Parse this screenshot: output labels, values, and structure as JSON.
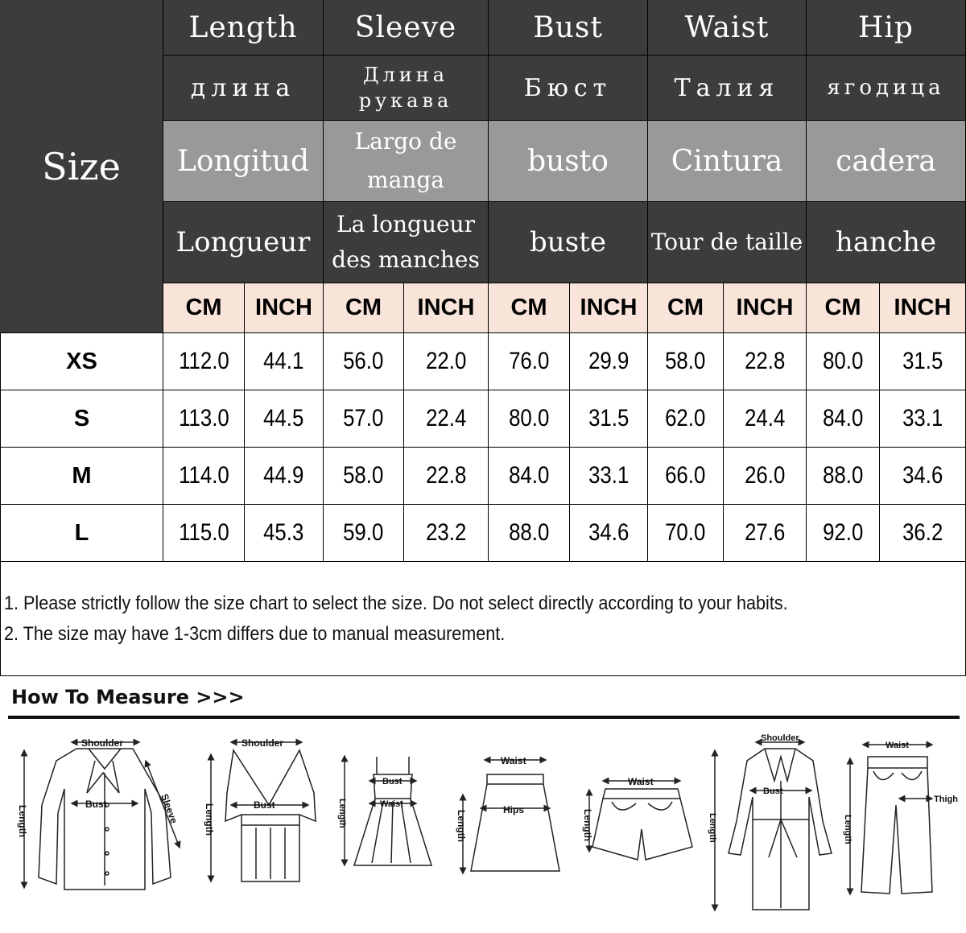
{
  "table": {
    "size_header": "Size",
    "columns": [
      {
        "en": "Length",
        "ru": "длина",
        "es": "Longitud",
        "fr": "Longueur"
      },
      {
        "en": "Sleeve",
        "ru": "Длина рукава",
        "es": "Largo de manga",
        "fr": "La longueur des manches"
      },
      {
        "en": "Bust",
        "ru": "Бюст",
        "es": "busto",
        "fr": "buste"
      },
      {
        "en": "Waist",
        "ru": "Талия",
        "es": "Cintura",
        "fr": "Tour de taille"
      },
      {
        "en": "Hip",
        "ru": "ягодица",
        "es": "cadera",
        "fr": "hanche"
      }
    ],
    "unit_cm": "CM",
    "unit_inch": "INCH",
    "rows": [
      {
        "size": "XS",
        "values": [
          "112.0",
          "44.1",
          "56.0",
          "22.0",
          "76.0",
          "29.9",
          "58.0",
          "22.8",
          "80.0",
          "31.5"
        ]
      },
      {
        "size": "S",
        "values": [
          "113.0",
          "44.5",
          "57.0",
          "22.4",
          "80.0",
          "31.5",
          "62.0",
          "24.4",
          "84.0",
          "33.1"
        ]
      },
      {
        "size": "M",
        "values": [
          "114.0",
          "44.9",
          "58.0",
          "22.8",
          "84.0",
          "33.1",
          "66.0",
          "26.0",
          "88.0",
          "34.6"
        ]
      },
      {
        "size": "L",
        "values": [
          "115.0",
          "45.3",
          "59.0",
          "23.2",
          "88.0",
          "34.6",
          "70.0",
          "27.6",
          "92.0",
          "36.2"
        ]
      }
    ]
  },
  "notes": [
    "1. Please strictly follow the size chart to select the size. Do not select directly according to your habits.",
    "2. The size may have 1-3cm differs due to manual measurement."
  ],
  "how_to_measure": {
    "title": "How To Measure >>>",
    "figures": [
      {
        "icon": "blouse-icon",
        "labels": {
          "shoulder": "Shoulder",
          "bust": "Bust",
          "length": "Length",
          "sleeve": "Sleeve"
        }
      },
      {
        "icon": "tank-top-icon",
        "labels": {
          "shoulder": "Shoulder",
          "bust": "Bust",
          "length": "Length"
        }
      },
      {
        "icon": "strap-dress-icon",
        "labels": {
          "bust": "Bust",
          "waist": "Waist",
          "length": "Length"
        }
      },
      {
        "icon": "skirt-icon",
        "labels": {
          "waist": "Waist",
          "hips": "Hips",
          "length": "Length"
        }
      },
      {
        "icon": "shorts-icon",
        "labels": {
          "waist": "Waist",
          "length": "Length"
        }
      },
      {
        "icon": "coat-icon",
        "labels": {
          "shoulder": "Shoulder",
          "bust": "Bust",
          "length": "Length"
        }
      },
      {
        "icon": "trousers-icon",
        "labels": {
          "waist": "Waist",
          "thigh": "Thigh",
          "length": "Length"
        }
      }
    ]
  }
}
